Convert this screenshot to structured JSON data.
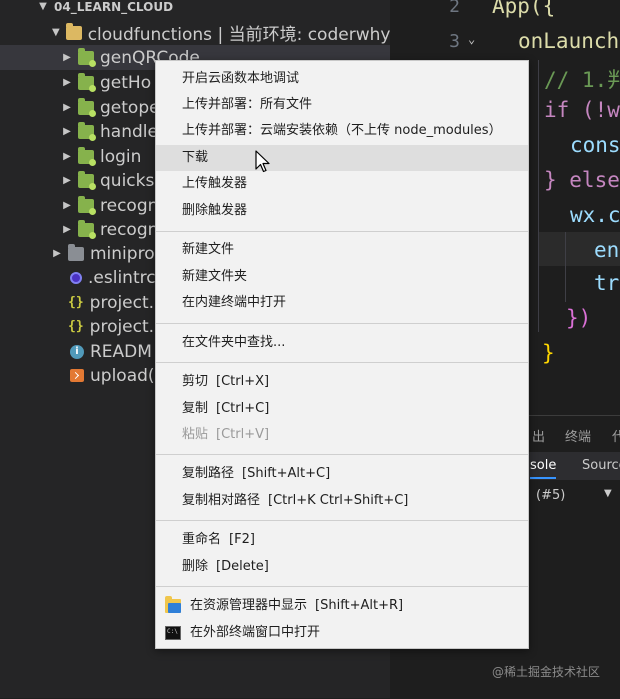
{
  "explorer": {
    "root": "04_LEARN_CLOUD",
    "items": [
      {
        "label": "cloudfunctions | 当前环境: coderwhy"
      },
      {
        "label": "genQRCode"
      },
      {
        "label": "getHo"
      },
      {
        "label": "getope"
      },
      {
        "label": "handle"
      },
      {
        "label": "login"
      },
      {
        "label": "quicks"
      },
      {
        "label": "recogn"
      },
      {
        "label": "recogn"
      },
      {
        "label": "minipro"
      },
      {
        "label": ".eslintrc"
      },
      {
        "label": "project."
      },
      {
        "label": "project."
      },
      {
        "label": "READM"
      },
      {
        "label": "upload("
      }
    ]
  },
  "editor": {
    "line_numbers": [
      "2",
      "3"
    ],
    "lines": [
      "App({",
      "onLaunch",
      "// 1.判",
      "if (!w",
      "cons",
      "} else",
      "wx.c",
      "en",
      "tr",
      "})",
      "}"
    ]
  },
  "panel": {
    "tabs": [
      "出",
      "终端",
      "代"
    ],
    "devtools_tabs": [
      "sole",
      "Source"
    ],
    "context_value": "(#5)"
  },
  "watermark": "@稀土掘金技术社区",
  "context_menu": {
    "items": [
      {
        "label": "开启云函数本地调试"
      },
      {
        "label": "上传并部署：所有文件"
      },
      {
        "label": "上传并部署：云端安装依赖（不上传 node_modules）"
      },
      {
        "label": "下载"
      },
      {
        "label": "上传触发器"
      },
      {
        "label": "删除触发器"
      },
      {
        "label": "新建文件"
      },
      {
        "label": "新建文件夹"
      },
      {
        "label": "在内建终端中打开"
      },
      {
        "label": "在文件夹中查找..."
      },
      {
        "label": "剪切",
        "shortcut": "[Ctrl+X]"
      },
      {
        "label": "复制",
        "shortcut": "[Ctrl+C]"
      },
      {
        "label": "粘贴",
        "shortcut": "[Ctrl+V]"
      },
      {
        "label": "复制路径",
        "shortcut": "[Shift+Alt+C]"
      },
      {
        "label": "复制相对路径",
        "shortcut": "[Ctrl+K Ctrl+Shift+C]"
      },
      {
        "label": "重命名",
        "shortcut": "[F2]"
      },
      {
        "label": "删除",
        "shortcut": "[Delete]"
      },
      {
        "label": "在资源管理器中显示",
        "shortcut": "[Shift+Alt+R]"
      },
      {
        "label": "在外部终端窗口中打开"
      }
    ]
  },
  "colors": {
    "keyword": "#c586c0",
    "function": "#dcdcaa",
    "comment": "#6a9955",
    "bracket": "#da70d6",
    "brace": "#ffd700"
  }
}
